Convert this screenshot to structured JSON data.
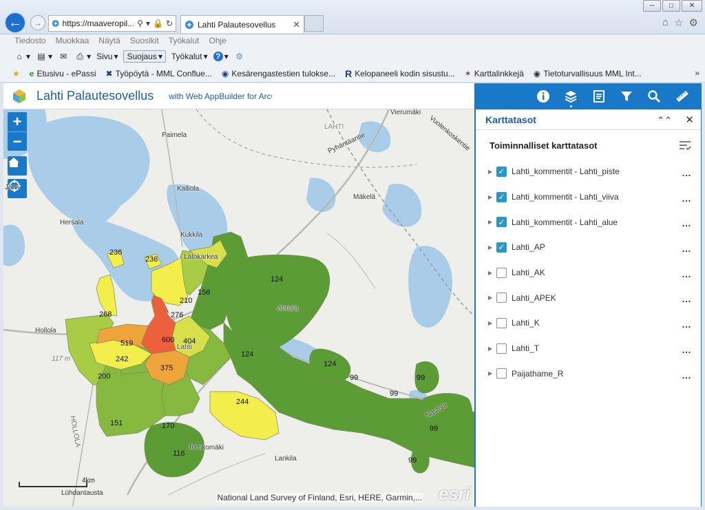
{
  "browser": {
    "address_text": "https://maaveropil...",
    "tab_title": "Lahti Palautesovellus",
    "menu": [
      "Tiedosto",
      "Muokkaa",
      "Näytä",
      "Suosikit",
      "Työkalut",
      "Ohje"
    ],
    "commands": {
      "page": "Sivu",
      "safety": "Suojaus",
      "tools": "Työkalut"
    },
    "favorites": [
      {
        "icon": "e-icon",
        "label": "Etusivu - ePassi"
      },
      {
        "icon": "x-icon",
        "label": "Työpöytä - MML Conflue..."
      },
      {
        "icon": "circle-icon",
        "label": "Kesärengastestien tulokse..."
      },
      {
        "icon": "r-icon",
        "label": "Kelopaneeli kodin sisustu..."
      },
      {
        "icon": "link-icon",
        "label": "Karttalinkkejä"
      },
      {
        "icon": "shield-icon",
        "label": "Tietoturvallisuus MML Int..."
      }
    ]
  },
  "app": {
    "title": "Lahti Palautesovellus",
    "subtitle": "with Web AppBuilder for ArcG"
  },
  "toolbar": [
    "info-icon",
    "layers-icon",
    "legend-icon",
    "filter-icon",
    "search-icon",
    "measure-icon"
  ],
  "map": {
    "places": {
      "vierumaki": "Vierumäki",
      "vuolenkoski": "Vuolenkoskentie",
      "paimela": "Paimela",
      "lahti_top": "LAHTI",
      "pyhantaantie": "Pyhäntäantie",
      "jarvi": "Järvi",
      "kalliola": "Kalliola",
      "makela": "Mäkelä",
      "hersala": "Hersala",
      "kukkila": "Kukkila",
      "latokarkea": "Latokarkea",
      "hollola": "Hollola",
      "ahtiala": "Ahtiala",
      "lahti_center": "Lahti",
      "nastola": "Nastola",
      "hollola_road": "HOLLOLA",
      "renkomaki": "Renkomäki",
      "lankila": "Lankila"
    },
    "values": {
      "v236a": "236",
      "v236b": "236",
      "v124a": "124",
      "v210": "210",
      "v156": "156",
      "v268": "268",
      "v276": "276",
      "v519": "519",
      "v600": "600",
      "v404": "404",
      "v242": "242",
      "v124b": "124",
      "v124c": "124",
      "v375": "375",
      "v200": "200",
      "v99a": "99",
      "v99b": "99",
      "v99c": "99",
      "v244": "244",
      "v151": "151",
      "v170": "170",
      "v99d": "99",
      "v116": "116",
      "v99e": "99"
    },
    "scale_label": "4km",
    "units_label": "Lühdantausta",
    "elevation_label": "117 m",
    "attribution": "National Land Survey of Finland, Esri, HERE, Garmin,...",
    "esri": "esri"
  },
  "panel": {
    "title": "Karttatasot",
    "section": "Toiminnalliset karttatasot",
    "layers": [
      {
        "name": "Lahti_kommentit - Lahti_piste",
        "checked": true
      },
      {
        "name": "Lahti_kommentit - Lahti_viiva",
        "checked": true
      },
      {
        "name": "Lahti_kommentit - Lahti_alue",
        "checked": true
      },
      {
        "name": "Lahti_AP",
        "checked": true
      },
      {
        "name": "Lahti_AK",
        "checked": false
      },
      {
        "name": "Lahti_APEK",
        "checked": false
      },
      {
        "name": "Lahti_K",
        "checked": false
      },
      {
        "name": "Lahti_T",
        "checked": false
      },
      {
        "name": "Paijathame_R",
        "checked": false
      }
    ]
  },
  "colors": {
    "accent": "#1a78c8",
    "dark_green": "#5b9c35",
    "green": "#87b840",
    "light_green": "#a9cc46",
    "yellow_green": "#d7e04a",
    "yellow": "#f3ee4c",
    "orange": "#f0a43c",
    "red": "#ee5f3b",
    "water": "#a9cde9"
  }
}
